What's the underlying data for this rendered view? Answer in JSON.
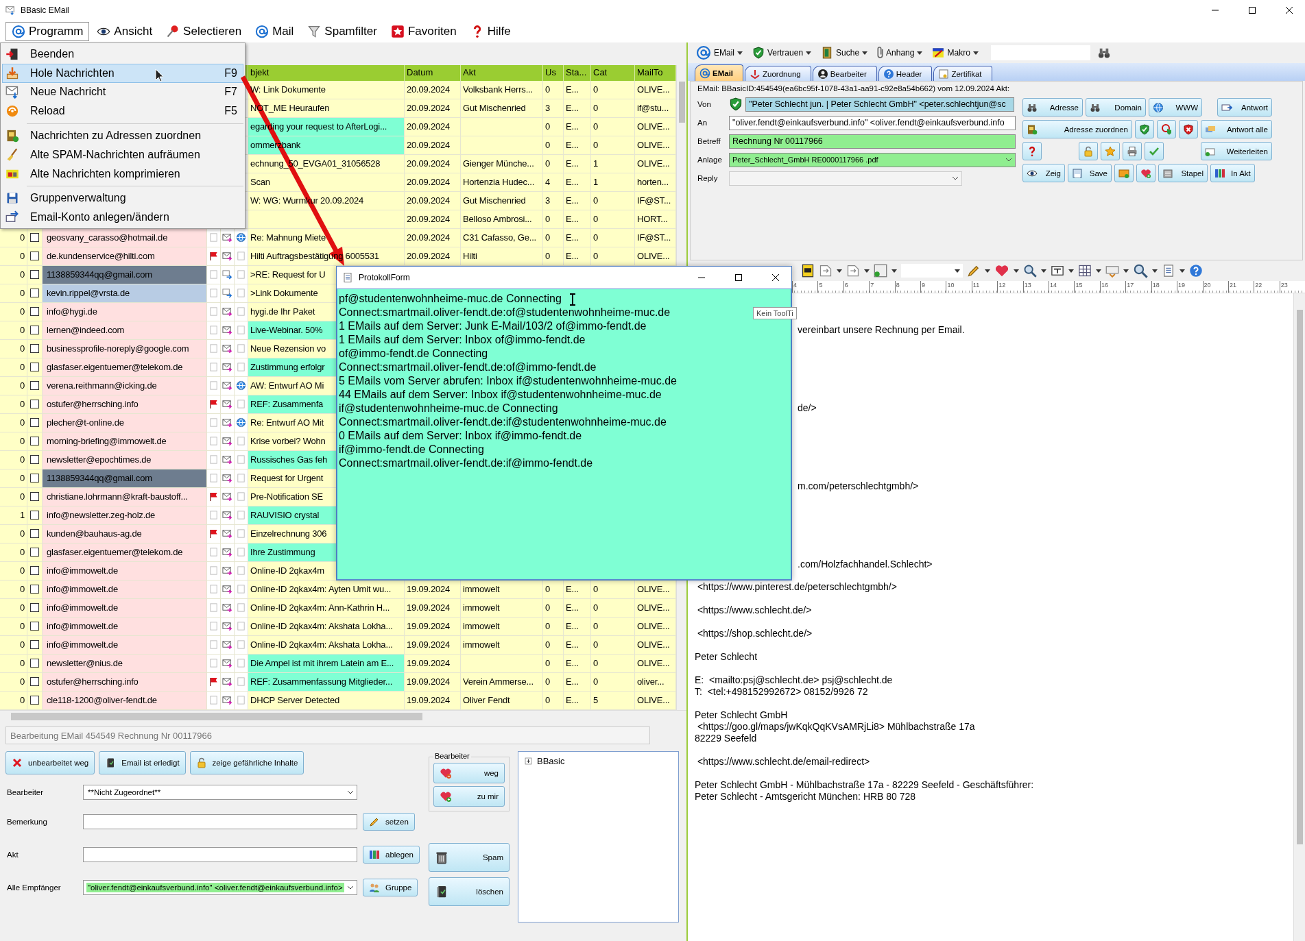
{
  "window": {
    "title": "BBasic EMail"
  },
  "menu_bar": [
    {
      "label": "Programm",
      "selected": true
    },
    {
      "label": "Ansicht",
      "selected": false
    },
    {
      "label": "Selectieren",
      "selected": false
    },
    {
      "label": "Mail",
      "selected": false
    },
    {
      "label": "Spamfilter",
      "selected": false
    },
    {
      "label": "Favoriten",
      "selected": false
    },
    {
      "label": "Hilfe",
      "selected": false
    }
  ],
  "program_menu": [
    {
      "kind": "item",
      "label": "Beenden",
      "selected": false
    },
    {
      "kind": "item",
      "label": "Hole Nachrichten",
      "shortcut": "F9",
      "selected": true
    },
    {
      "kind": "item",
      "label": "Neue Nachricht",
      "shortcut": "F7",
      "selected": false
    },
    {
      "kind": "item",
      "label": "Reload",
      "shortcut": "F5",
      "selected": false
    },
    {
      "kind": "separator"
    },
    {
      "kind": "item",
      "label": "Nachrichten zu Adressen zuordnen",
      "selected": false
    },
    {
      "kind": "item",
      "label": "Alte SPAM-Nachrichten aufräumen",
      "selected": false
    },
    {
      "kind": "item",
      "label": "Alte Nachrichten komprimieren",
      "selected": false
    },
    {
      "kind": "separator"
    },
    {
      "kind": "item",
      "label": "Gruppenverwaltung",
      "selected": false
    },
    {
      "kind": "item",
      "label": "Email-Konto anlegen/ändern",
      "selected": false
    }
  ],
  "message_list": {
    "columns": [
      "bjekt",
      "Datum",
      "Akt",
      "Us",
      "Sta...",
      "Cat",
      "MailTo"
    ],
    "rows": [
      {
        "subject": "W: Link Dokumente",
        "color": "#ffffc6",
        "date": "20.09.2024",
        "akt": "Volksbank  Herrs...",
        "us": "0",
        "sta": "E...",
        "cat": "0",
        "mailto": "OLIVE..."
      },
      {
        "subject": "NOT_ME Heuraufen",
        "color": "#ffffc6",
        "date": "20.09.2024",
        "akt": "Gut Mischenried",
        "us": "3",
        "sta": "E...",
        "cat": "0",
        "mailto": "if@stu..."
      },
      {
        "subject": "egarding your request to AfterLogi...",
        "color": "#7fffd4",
        "date": "20.09.2024",
        "us": "0",
        "sta": "E...",
        "cat": "0",
        "mailto": "OLIVE..."
      },
      {
        "subject": "ommerzbank",
        "color": "#7fffd4",
        "date": "20.09.2024",
        "us": "0",
        "sta": "E...",
        "cat": "0",
        "mailto": "OLIVE..."
      },
      {
        "subject": "echnung_50_EVGA01_31056528",
        "color": "#ffffc6",
        "date": "20.09.2024",
        "akt": "Gienger  Münche...",
        "us": "0",
        "sta": "E...",
        "cat": "1",
        "mailto": "OLIVE..."
      },
      {
        "subject": "Scan",
        "color": "#ffffc6",
        "date": "20.09.2024",
        "akt": "Hortenzia  Hudec...",
        "us": "4",
        "sta": "E...",
        "cat": "1",
        "mailto": "horten..."
      },
      {
        "subject": "W: WG: Wurmkur 20.09.2024",
        "color": "#ffffc6",
        "date": "20.09.2024",
        "akt": "Gut Mischenried",
        "us": "3",
        "sta": "E...",
        "cat": "0",
        "mailto": "IF@ST..."
      },
      {
        "color": "#ffffc6",
        "date": "20.09.2024",
        "akt": "Belloso  Ambrosi...",
        "us": "0",
        "sta": "E...",
        "cat": "0",
        "mailto": "HORT..."
      },
      {
        "count": "0",
        "checked": false,
        "sender": "geosvany_carasso@hotmail.de",
        "selected": false,
        "marked": false,
        "flagged": false,
        "forwarded": false,
        "linked": true,
        "subject": "Re: Mahnung Miete",
        "color": "#ffffc6",
        "date": "20.09.2024",
        "akt": "C31 Cafasso, Ge...",
        "us": "0",
        "sta": "E...",
        "cat": "0",
        "mailto": "IF@ST..."
      },
      {
        "count": "0",
        "checked": false,
        "sender": "de.kundenservice@hilti.com",
        "selected": false,
        "marked": false,
        "flagged": true,
        "forwarded": false,
        "linked": false,
        "subject": "Hilti  Auftragsbestätigung 6005531",
        "color": "#ffffc6",
        "date": "20.09.2024",
        "akt": "Hilti",
        "us": "0",
        "sta": "E...",
        "cat": "0",
        "mailto": "OLIVE..."
      },
      {
        "count": "0",
        "checked": false,
        "sender": "1138859344qq@gmail.com",
        "selected": true,
        "marked": false,
        "flagged": false,
        "forwarded": true,
        "linked": false,
        "subject": ">RE: Request for U",
        "color": "#ffffc6"
      },
      {
        "count": "0",
        "checked": false,
        "sender": "kevin.rippel@vrsta.de",
        "selected": false,
        "marked": true,
        "flagged": false,
        "forwarded": true,
        "linked": false,
        "subject": ">Link Dokumente",
        "color": "#ffffc6"
      },
      {
        "count": "0",
        "checked": false,
        "sender": "info@hygi.de",
        "selected": false,
        "marked": false,
        "flagged": false,
        "forwarded": false,
        "linked": false,
        "subject": "hygi.de   Ihr Paket",
        "color": "#ffffc6"
      },
      {
        "count": "0",
        "checked": false,
        "sender": "lernen@indeed.com",
        "selected": false,
        "marked": false,
        "flagged": false,
        "forwarded": false,
        "linked": false,
        "subject": "Live-Webinar. 50%",
        "color": "#7fffd4"
      },
      {
        "count": "0",
        "checked": false,
        "sender": "businessprofile-noreply@google.com",
        "selected": false,
        "marked": false,
        "flagged": false,
        "forwarded": false,
        "linked": false,
        "subject": "Neue Rezension vo",
        "color": "#ffffc6"
      },
      {
        "count": "0",
        "checked": false,
        "sender": "glasfaser.eigentuemer@telekom.de",
        "selected": false,
        "marked": false,
        "flagged": false,
        "forwarded": false,
        "linked": false,
        "subject": "Zustimmung erfolgr",
        "color": "#7fffd4"
      },
      {
        "count": "0",
        "checked": false,
        "sender": "verena.reithmann@icking.de",
        "selected": false,
        "marked": false,
        "flagged": false,
        "forwarded": false,
        "linked": true,
        "subject": "AW: Entwurf AO Mi",
        "color": "#ffffc6"
      },
      {
        "count": "0",
        "checked": false,
        "sender": "ostufer@herrsching.info",
        "selected": false,
        "marked": false,
        "flagged": true,
        "forwarded": false,
        "linked": false,
        "subject": "REF:  Zusammenfa",
        "color": "#7fffd4"
      },
      {
        "count": "0",
        "checked": false,
        "sender": "plecher@t-online.de",
        "selected": false,
        "marked": false,
        "flagged": false,
        "forwarded": false,
        "linked": true,
        "subject": "Re: Entwurf AO Mit",
        "color": "#ffffc6"
      },
      {
        "count": "0",
        "checked": false,
        "sender": "morning-briefing@immowelt.de",
        "selected": false,
        "marked": false,
        "flagged": false,
        "forwarded": false,
        "linked": false,
        "subject": "Krise  vorbei?  Wohn",
        "color": "#ffffc6"
      },
      {
        "count": "0",
        "checked": false,
        "sender": "newsletter@epochtimes.de",
        "selected": false,
        "marked": false,
        "flagged": false,
        "forwarded": false,
        "linked": false,
        "subject": "Russisches Gas feh",
        "color": "#7fffd4"
      },
      {
        "count": "0",
        "checked": false,
        "sender": "1138859344qq@gmail.com",
        "selected": true,
        "marked": false,
        "flagged": false,
        "forwarded": false,
        "linked": false,
        "subject": "Request for Urgent",
        "color": "#ffffc6"
      },
      {
        "count": "0",
        "checked": false,
        "sender": "christiane.lohrmann@kraft-baustoff...",
        "selected": false,
        "marked": false,
        "flagged": true,
        "forwarded": false,
        "linked": false,
        "subject": "Pre-Notification SE",
        "color": "#ffffc6"
      },
      {
        "count": "1",
        "checked": false,
        "sender": "info@newsletter.zeg-holz.de",
        "selected": false,
        "marked": false,
        "flagged": false,
        "forwarded": false,
        "linked": false,
        "subject": "RAUVISIO crystal",
        "color": "#7fffd4"
      },
      {
        "count": "0",
        "checked": false,
        "sender": "kunden@bauhaus-ag.de",
        "selected": false,
        "marked": false,
        "flagged": true,
        "forwarded": false,
        "linked": false,
        "subject": "Einzelrechnung 306",
        "color": "#ffffc6"
      },
      {
        "count": "0",
        "checked": false,
        "sender": "glasfaser.eigentuemer@telekom.de",
        "selected": false,
        "marked": false,
        "flagged": false,
        "forwarded": false,
        "linked": false,
        "subject": "Ihre Zustimmung",
        "color": "#7fffd4"
      },
      {
        "count": "0",
        "checked": false,
        "sender": "info@immowelt.de",
        "selected": false,
        "marked": false,
        "flagged": false,
        "forwarded": false,
        "linked": false,
        "subject": "Online-ID 2qkax4m",
        "color": "#ffffc6"
      },
      {
        "count": "0",
        "checked": false,
        "sender": "info@immowelt.de",
        "selected": false,
        "marked": false,
        "flagged": false,
        "forwarded": false,
        "linked": false,
        "subject": "Online-ID 2qkax4m:  Ayten Umit wu...",
        "color": "#ffffc6",
        "date": "19.09.2024",
        "akt": "immowelt",
        "us": "0",
        "sta": "E...",
        "cat": "0",
        "mailto": "OLIVE..."
      },
      {
        "count": "0",
        "checked": false,
        "sender": "info@immowelt.de",
        "selected": false,
        "marked": false,
        "flagged": false,
        "forwarded": false,
        "linked": false,
        "subject": "Online-ID 2qkax4m:  Ann-Kathrin H...",
        "color": "#ffffc6",
        "date": "19.09.2024",
        "akt": "immowelt",
        "us": "0",
        "sta": "E...",
        "cat": "0",
        "mailto": "OLIVE..."
      },
      {
        "count": "0",
        "checked": false,
        "sender": "info@immowelt.de",
        "selected": false,
        "marked": false,
        "flagged": false,
        "forwarded": false,
        "linked": false,
        "subject": "Online-ID 2qkax4m:  Akshata Lokha...",
        "color": "#ffffc6",
        "date": "19.09.2024",
        "akt": "immowelt",
        "us": "0",
        "sta": "E...",
        "cat": "0",
        "mailto": "OLIVE..."
      },
      {
        "count": "0",
        "checked": false,
        "sender": "info@immowelt.de",
        "selected": false,
        "marked": false,
        "flagged": false,
        "forwarded": false,
        "linked": false,
        "subject": "Online-ID 2qkax4m:  Akshata Lokha...",
        "color": "#ffffc6",
        "date": "19.09.2024",
        "akt": "immowelt",
        "us": "0",
        "sta": "E...",
        "cat": "0",
        "mailto": "OLIVE..."
      },
      {
        "count": "0",
        "checked": false,
        "sender": "newsletter@nius.de",
        "selected": false,
        "marked": false,
        "flagged": false,
        "forwarded": false,
        "linked": false,
        "subject": "Die Ampel ist mit ihrem Latein am E...",
        "color": "#7fffd4",
        "date": "19.09.2024",
        "us": "0",
        "sta": "E...",
        "cat": "0",
        "mailto": "OLIVE..."
      },
      {
        "count": "0",
        "checked": false,
        "sender": "ostufer@herrsching.info",
        "selected": false,
        "marked": false,
        "flagged": true,
        "forwarded": false,
        "linked": false,
        "subject": "REF:  Zusammenfassung Mitglieder...",
        "color": "#7fffd4",
        "date": "19.09.2024",
        "akt": "Verein  Ammerse...",
        "us": "0",
        "sta": "E...",
        "cat": "0",
        "mailto": "oliver..."
      },
      {
        "count": "0",
        "checked": false,
        "sender": "cle118-1200@oliver-fendt.de",
        "selected": false,
        "marked": false,
        "flagged": false,
        "forwarded": false,
        "linked": false,
        "subject": "DHCP Server Detected",
        "color": "#ffffc6",
        "date": "19.09.2024",
        "akt": "Oliver Fendt",
        "us": "0",
        "sta": "E...",
        "cat": "5",
        "mailto": "OLIVE..."
      }
    ]
  },
  "edit_status": "Bearbeitung EMail 454549 Rechnung Nr 00117966",
  "edit_buttons": [
    "unbearbeitet weg",
    "Email ist erledigt",
    "zeige gefährliche Inhalte"
  ],
  "assignee_group": {
    "title": "Bearbeiter",
    "buttons": [
      "weg",
      "zu mir"
    ]
  },
  "form_fields": [
    {
      "label": "Bearbeiter",
      "kind": "select",
      "value": "**Nicht Zugeordnet**",
      "highlighted": false
    },
    {
      "label": "Bemerkung",
      "kind": "input",
      "button": "setzen",
      "highlighted": false
    },
    {
      "label": "Akt",
      "kind": "input",
      "button": "ablegen",
      "highlighted": false
    },
    {
      "label": "Alle Empfänger",
      "kind": "select",
      "value": "\"oliver.fendt@einkaufsverbund.info\" <oliver.fendt@einkaufsverbund.info>",
      "button": "Gruppe",
      "highlighted": true
    }
  ],
  "side_buttons": [
    "Spam",
    "löschen"
  ],
  "tree": [
    {
      "label": "BBasic",
      "expanded": false
    }
  ],
  "email_toolbar": [
    "EMail",
    "Vertrauen",
    "Suche",
    "Anhang",
    "Makro"
  ],
  "email_tabs": [
    {
      "label": "EMail",
      "selected": true
    },
    {
      "label": "Zuordnung",
      "selected": false
    },
    {
      "label": "Bearbeiter",
      "selected": false
    },
    {
      "label": "Header",
      "selected": false
    },
    {
      "label": "Zertifikat",
      "selected": false
    }
  ],
  "email_info": "EMail: BBasicID:454549(ea6bc95f-1078-43a1-aa91-c92e8a54b662) vom 12.09.2024 Akt:",
  "email_fields": [
    {
      "label": "Von",
      "kind": "sender",
      "value": "\"Peter Schlecht jun. | Peter Schlecht GmbH\" <peter.schlechtjun@sc",
      "disabled": false
    },
    {
      "label": "An",
      "kind": "text",
      "value": "\"oliver.fendt@einkaufsverbund.info\" <oliver.fendt@einkaufsverbund.info",
      "disabled": false
    },
    {
      "label": "Betreff",
      "kind": "subject",
      "value": "Rechnung Nr 00117966",
      "disabled": false
    },
    {
      "label": "Anlage",
      "kind": "select",
      "value": "Peter_Schlecht_GmbH RE0000117966 .pdf",
      "disabled": false
    },
    {
      "label": "Reply",
      "kind": "select",
      "disabled": true
    }
  ],
  "action_buttons": [
    [
      {
        "kind": "labeled",
        "label": "Adresse"
      },
      {
        "kind": "labeled",
        "label": "Domain"
      },
      {
        "kind": "labeled",
        "label": "WWW"
      },
      {
        "kind": "spacer"
      },
      {
        "kind": "labeled",
        "label": "Antwort"
      }
    ],
    [
      {
        "kind": "labeled",
        "label": "Adresse zuordnen"
      },
      {
        "kind": "icon"
      },
      {
        "kind": "icon"
      },
      {
        "kind": "icon"
      },
      {
        "kind": "labeled",
        "label": "Antwort alle"
      }
    ],
    [
      {
        "kind": "icon"
      },
      {
        "kind": "spacer"
      },
      {
        "kind": "icon"
      },
      {
        "kind": "icon"
      },
      {
        "kind": "icon"
      },
      {
        "kind": "icon"
      },
      {
        "kind": "spacer"
      },
      {
        "kind": "labeled",
        "label": "Weiterleiten"
      }
    ],
    [
      {
        "kind": "labeled",
        "label": "Zeig"
      },
      {
        "kind": "labeled",
        "label": "Save"
      },
      {
        "kind": "icon"
      },
      {
        "kind": "icon"
      },
      {
        "kind": "labeled",
        "label": "Stapel"
      },
      {
        "kind": "labeled",
        "label": "In Akt"
      }
    ]
  ],
  "editor": {
    "ruler_marks": [
      "4",
      "5",
      "6",
      "7",
      "8",
      "9",
      "10",
      "11",
      "12",
      "13",
      "14",
      "15",
      "16",
      "17",
      "18",
      "19",
      "20",
      "21",
      "22",
      "23"
    ],
    "paragraphs": [
      {
        "partly_covered": true,
        "lines": [
          "vereinbart unsere Rechnung per Email."
        ]
      },
      {
        "partly_covered": true,
        "lines": [
          "de/>"
        ]
      },
      {
        "partly_covered": true,
        "lines": [
          "m.com/peterschlechtgmbh/>"
        ]
      },
      {
        "partly_covered": true,
        "lines": [
          ".com/Holzfachhandel.Schlecht>"
        ]
      },
      {
        "partly_covered": false,
        "lines": [
          " <https://www.pinterest.de/peterschlechtgmbh/>"
        ]
      },
      {
        "partly_covered": false,
        "lines": [
          " <https://www.schlecht.de/>"
        ]
      },
      {
        "partly_covered": false,
        "lines": [
          " <https://shop.schlecht.de/>"
        ]
      },
      {
        "partly_covered": false,
        "lines": [
          "Peter Schlecht"
        ]
      },
      {
        "partly_covered": false,
        "lines": [
          "E:  <mailto:psj@schlecht.de> psj@schlecht.de",
          "T:  <tel:+498152992672> 08152/9926 72"
        ]
      },
      {
        "partly_covered": false,
        "lines": [
          "Peter Schlecht GmbH",
          " <https://goo.gl/maps/jwKqkQqKVsAMRjLi8> Mühlbachstraße 17a",
          "82229 Seefeld"
        ]
      },
      {
        "partly_covered": false,
        "lines": [
          " <https://www.schlecht.de/email-redirect>"
        ]
      },
      {
        "partly_covered": false,
        "lines": [
          "Peter Schlecht GmbH - Mühlbachstraße 17a - 82229 Seefeld - Geschäftsführer:",
          "Peter Schlecht - Amtsgericht München: HRB 80 728"
        ]
      }
    ]
  },
  "protocol_window": {
    "title": "ProtokollForm",
    "lines": [
      "pf@studentenwohnheime-muc.de Connecting",
      "Connect:smartmail.oliver-fendt.de:of@studentenwohnheime-muc.de",
      "1 EMails auf dem Server: Junk E-Mail/103/2 of@immo-fendt.de",
      "1 EMails auf dem Server: Inbox of@immo-fendt.de",
      "of@immo-fendt.de Connecting",
      "Connect:smartmail.oliver-fendt.de:of@immo-fendt.de",
      "5 EMails vom Server abrufen: Inbox if@studentenwohnheime-muc.de",
      "44 EMails auf dem Server: Inbox if@studentenwohnheime-muc.de",
      "if@studentenwohnheime-muc.de Connecting",
      "Connect:smartmail.oliver-fendt.de:if@studentenwohnheime-muc.de",
      "0 EMails auf dem Server: Inbox if@immo-fendt.de",
      "if@immo-fendt.de Connecting",
      "Connect:smartmail.oliver-fendt.de:if@immo-fendt.de"
    ]
  },
  "tooltip": "Kein ToolTi"
}
